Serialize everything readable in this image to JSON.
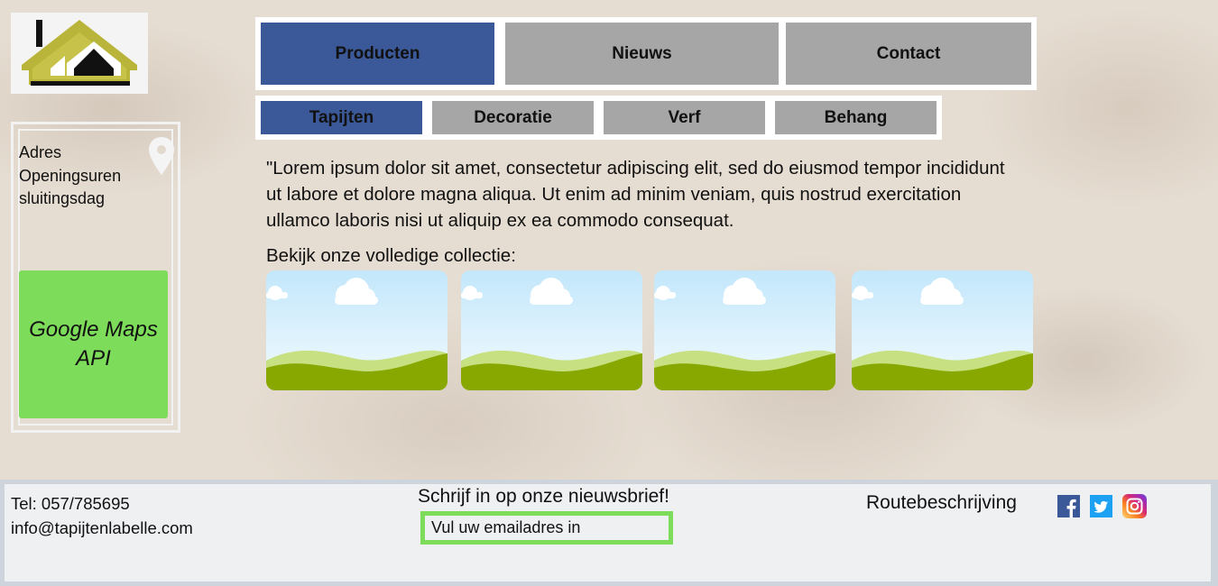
{
  "logo": {
    "icon": "house-logo-icon"
  },
  "sidebar": {
    "info_lines": [
      "Adres",
      "Openingsuren",
      "sluitingsdag"
    ],
    "pin_icon": "location-pin-icon",
    "map_label_line1": "Google Maps",
    "map_label_line2": "API"
  },
  "nav": {
    "main": [
      {
        "label": "Producten",
        "active": true
      },
      {
        "label": "Nieuws",
        "active": false
      },
      {
        "label": "Contact",
        "active": false
      }
    ],
    "sub": [
      {
        "label": "Tapijten",
        "active": true
      },
      {
        "label": "Decoratie",
        "active": false
      },
      {
        "label": "Verf",
        "active": false
      },
      {
        "label": "Behang",
        "active": false
      }
    ]
  },
  "main": {
    "lorem": "\"Lorem ipsum dolor sit amet, consectetur adipiscing elit, sed do eiusmod tempor incididunt ut labore et dolore magna aliqua. Ut enim ad minim veniam, quis nostrud exercitation ullamco laboris nisi ut aliquip ex ea commodo consequat.",
    "collection_label": "Bekijk onze volledige collectie:",
    "thumbnails": [
      "image-placeholder-icon",
      "image-placeholder-icon",
      "image-placeholder-icon",
      "image-placeholder-icon"
    ]
  },
  "footer": {
    "phone": "Tel: 057/785695",
    "email": "info@tapijtenlabelle.com",
    "newsletter_title": "Schrijf in op onze nieuwsbrief!",
    "email_placeholder": "Vul uw emailadres in",
    "route_label": "Routebeschrijving",
    "social": [
      "facebook-icon",
      "twitter-icon",
      "instagram-icon"
    ]
  },
  "colors": {
    "active_tab": "#3b5998",
    "inactive_tab": "#a6a6a6",
    "accent_green": "#7edc5b"
  }
}
